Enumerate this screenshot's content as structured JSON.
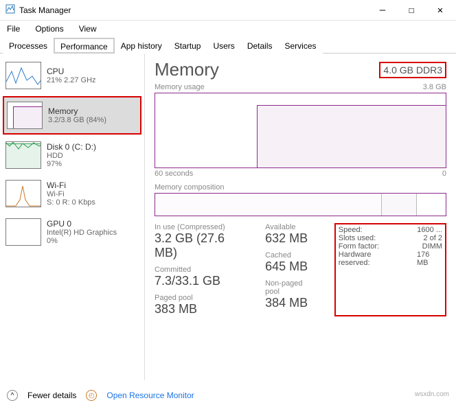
{
  "window": {
    "title": "Task Manager"
  },
  "menu": {
    "file": "File",
    "options": "Options",
    "view": "View"
  },
  "tabs": {
    "processes": "Processes",
    "performance": "Performance",
    "app_history": "App history",
    "startup": "Startup",
    "users": "Users",
    "details": "Details",
    "services": "Services"
  },
  "sidebar": {
    "cpu": {
      "title": "CPU",
      "sub": "21% 2.27 GHz"
    },
    "memory": {
      "title": "Memory",
      "sub": "3.2/3.8 GB (84%)"
    },
    "disk": {
      "title": "Disk 0 (C: D:)",
      "sub1": "HDD",
      "sub2": "97%"
    },
    "wifi": {
      "title": "Wi-Fi",
      "sub1": "Wi-Fi",
      "sub2": "S: 0 R: 0 Kbps"
    },
    "gpu": {
      "title": "GPU 0",
      "sub1": "Intel(R) HD Graphics",
      "sub2": "0%"
    }
  },
  "main": {
    "title": "Memory",
    "ram_spec": "4.0 GB DDR3",
    "usage_label": "Memory usage",
    "usage_max": "3.8 GB",
    "x_left": "60 seconds",
    "x_right": "0",
    "comp_label": "Memory composition",
    "stats": {
      "in_use_lbl": "In use (Compressed)",
      "in_use_val": "3.2 GB (27.6 MB)",
      "committed_lbl": "Committed",
      "committed_val": "7.3/33.1 GB",
      "paged_lbl": "Paged pool",
      "paged_val": "383 MB",
      "available_lbl": "Available",
      "available_val": "632 MB",
      "cached_lbl": "Cached",
      "cached_val": "645 MB",
      "nonpaged_lbl": "Non-paged pool",
      "nonpaged_val": "384 MB"
    },
    "info": {
      "speed_lbl": "Speed:",
      "speed_val": "1600 ...",
      "slots_lbl": "Slots used:",
      "slots_val": "2 of 2",
      "form_lbl": "Form factor:",
      "form_val": "DIMM",
      "hw_lbl": "Hardware reserved:",
      "hw_val": "176 MB"
    }
  },
  "footer": {
    "fewer": "Fewer details",
    "orm": "Open Resource Monitor"
  },
  "watermark": "wsxdn.com",
  "chart_data": {
    "type": "line",
    "title": "Memory usage",
    "xlabel": "seconds",
    "ylabel": "GB",
    "x": [
      60,
      55,
      50,
      45,
      40,
      35,
      30,
      25,
      20,
      15,
      10,
      5,
      0
    ],
    "values": [
      0,
      0,
      0,
      0,
      0,
      3.2,
      3.2,
      3.2,
      3.2,
      3.2,
      3.2,
      3.2,
      3.2
    ],
    "ylim": [
      0,
      3.8
    ]
  }
}
